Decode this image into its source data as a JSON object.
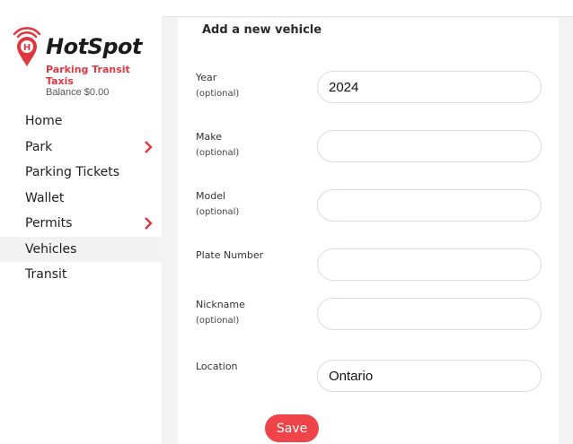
{
  "brand": {
    "name": "HotSpot",
    "tagline": "Parking Transit Taxis",
    "pin_letter": "H",
    "accent_color": "#e0363e"
  },
  "balance": "Balance $0.00",
  "nav": {
    "items": [
      {
        "label": "Home",
        "has_submenu": false,
        "active": false
      },
      {
        "label": "Park",
        "has_submenu": true,
        "active": false
      },
      {
        "label": "Parking Tickets",
        "has_submenu": false,
        "active": false
      },
      {
        "label": "Wallet",
        "has_submenu": false,
        "active": false
      },
      {
        "label": "Permits",
        "has_submenu": true,
        "active": false
      },
      {
        "label": "Vehicles",
        "has_submenu": false,
        "active": true
      },
      {
        "label": "Transit",
        "has_submenu": false,
        "active": false
      }
    ]
  },
  "form": {
    "title": "Add a new vehicle",
    "fields": {
      "year": {
        "label": "Year",
        "note": "(optional)",
        "value": "2024"
      },
      "make": {
        "label": "Make",
        "note": "(optional)",
        "value": ""
      },
      "model": {
        "label": "Model",
        "note": "(optional)",
        "value": ""
      },
      "plate": {
        "label": "Plate Number",
        "value": ""
      },
      "nickname": {
        "label": "Nickname",
        "note": "(optional)",
        "value": ""
      },
      "location": {
        "label": "Location",
        "value": "Ontario"
      }
    },
    "save_label": "Save"
  }
}
